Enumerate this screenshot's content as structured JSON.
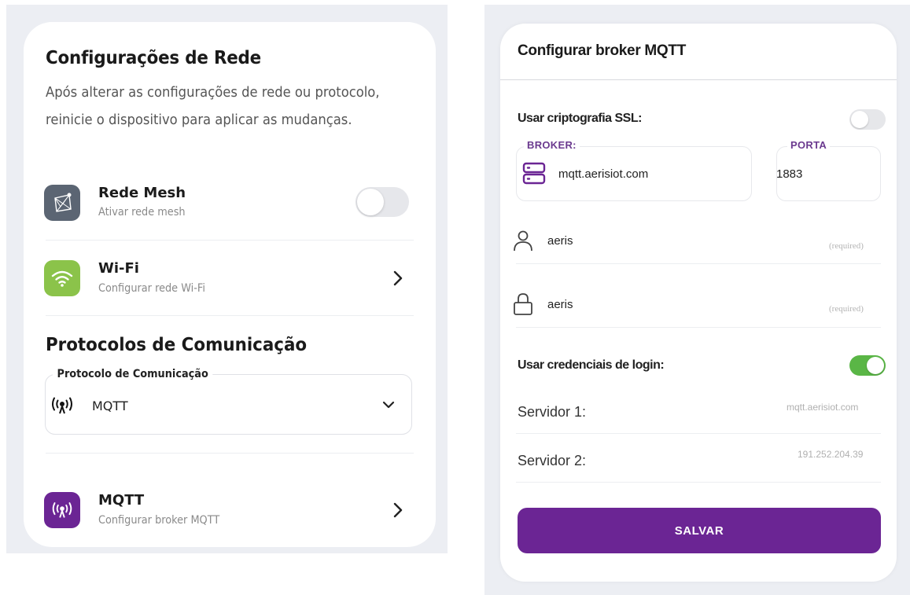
{
  "network_settings": {
    "title": "Configurações de Rede",
    "description_line1": "Após alterar as configurações de rede ou protocolo,",
    "description_line2": "reinicie o dispositivo para aplicar as mudanças.",
    "mesh": {
      "title": "Rede Mesh",
      "subtitle": "Ativar rede mesh",
      "enabled": false,
      "icon": "mesh-network-icon"
    },
    "wifi": {
      "title": "Wi-Fi",
      "subtitle": "Configurar rede Wi-Fi",
      "icon": "wifi-icon",
      "color": "#8bc34a"
    },
    "protocols_title": "Protocolos de Comunicação",
    "protocol_select": {
      "label": "Protocolo de Comunicação",
      "value": "MQTT",
      "icon": "broadcast-icon"
    },
    "mqtt": {
      "title": "MQTT",
      "subtitle": "Configurar broker MQTT",
      "icon": "broadcast-icon",
      "color": "#6b2594"
    }
  },
  "mqtt_broker": {
    "title": "Configurar broker MQTT",
    "ssl_label": "Usar criptografia SSL:",
    "ssl_enabled": false,
    "broker_label": "BROKER:",
    "broker_value": "mqtt.aerisiot.com",
    "port_label": "PORTA",
    "port_value": "1883",
    "username_value": "aeris",
    "username_hint": "(required)",
    "password_value": "aeris",
    "password_hint": "(required)",
    "credentials_label": "Usar credenciais de login:",
    "credentials_enabled": true,
    "server1_label": "Servidor 1:",
    "server1_value": "mqtt.aerisiot.com",
    "server2_label": "Servidor 2:",
    "server2_value": "191.252.204.39",
    "save_label": "SALVAR",
    "accent_color": "#6b2594",
    "toggle_on_color": "#5ab646"
  }
}
